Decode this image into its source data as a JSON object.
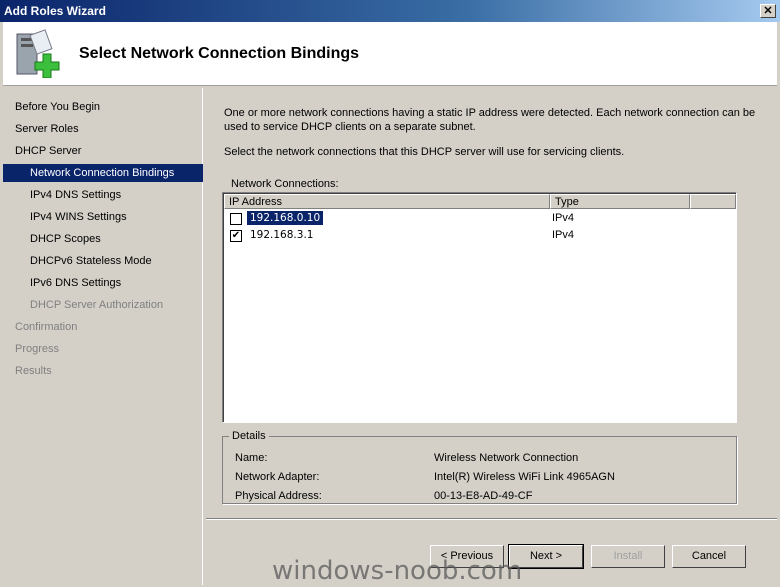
{
  "window": {
    "title": "Add Roles Wizard",
    "close": "✕"
  },
  "header": {
    "title": "Select Network Connection Bindings",
    "icon": "server-add-icon"
  },
  "sidebar": {
    "items": [
      {
        "label": "Before You Begin",
        "state": "normal",
        "level": 0
      },
      {
        "label": "Server Roles",
        "state": "normal",
        "level": 0
      },
      {
        "label": "DHCP Server",
        "state": "normal",
        "level": 0
      },
      {
        "label": "Network Connection Bindings",
        "state": "active",
        "level": 1
      },
      {
        "label": "IPv4 DNS Settings",
        "state": "normal",
        "level": 1
      },
      {
        "label": "IPv4 WINS Settings",
        "state": "normal",
        "level": 1
      },
      {
        "label": "DHCP Scopes",
        "state": "normal",
        "level": 1
      },
      {
        "label": "DHCPv6 Stateless Mode",
        "state": "normal",
        "level": 1
      },
      {
        "label": "IPv6 DNS Settings",
        "state": "normal",
        "level": 1
      },
      {
        "label": "DHCP Server Authorization",
        "state": "disabled",
        "level": 1
      },
      {
        "label": "Confirmation",
        "state": "disabled",
        "level": 0
      },
      {
        "label": "Progress",
        "state": "disabled",
        "level": 0
      },
      {
        "label": "Results",
        "state": "disabled",
        "level": 0
      }
    ]
  },
  "main": {
    "intro": "One or more network connections having a static IP address were detected. Each network connection can be used to service DHCP clients on a separate subnet.",
    "instruction": "Select the network connections that this DHCP server will use for servicing clients.",
    "list_label": "Network Connections:",
    "columns": [
      "IP Address",
      "Type",
      ""
    ],
    "rows": [
      {
        "ip": "192.168.0.10",
        "type": "IPv4",
        "checked": false,
        "selected": true
      },
      {
        "ip": "192.168.3.1",
        "type": "IPv4",
        "checked": true,
        "selected": false
      }
    ],
    "details": {
      "title": "Details",
      "fields": [
        {
          "key": "Name:",
          "value": "Wireless Network Connection"
        },
        {
          "key": "Network Adapter:",
          "value": "Intel(R) Wireless WiFi Link 4965AGN"
        },
        {
          "key": "Physical Address:",
          "value": "00-13-E8-AD-49-CF"
        }
      ]
    }
  },
  "buttons": {
    "previous": "< Previous",
    "next": "Next >",
    "install": "Install",
    "cancel": "Cancel"
  },
  "watermark": "windows-noob.com"
}
